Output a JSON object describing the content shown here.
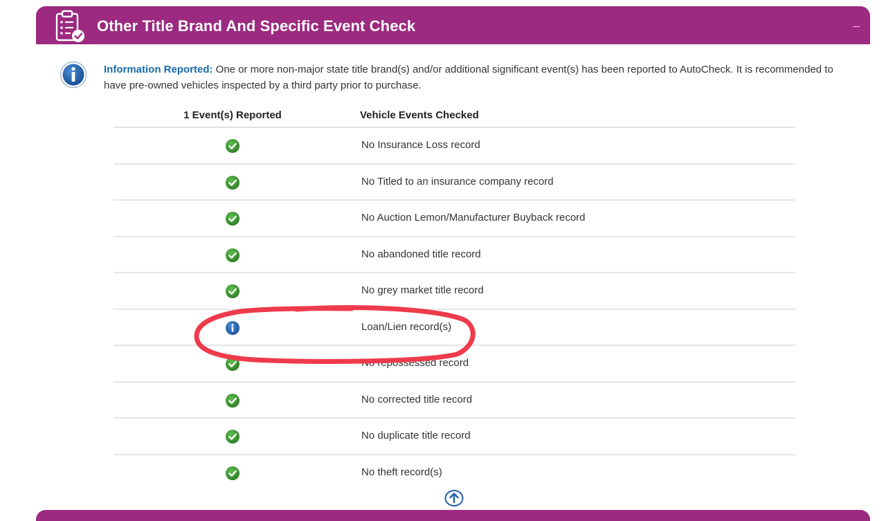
{
  "section": {
    "title": "Other Title Brand And Specific Event Check",
    "collapse_label": "–"
  },
  "info": {
    "label": "Information Reported:",
    "text": " One or more non-major state title brand(s) and/or additional significant event(s) has been reported to AutoCheck. It is recommended to have pre-owned vehicles inspected by a third party prior to purchase."
  },
  "table": {
    "headers": {
      "events_reported": "1 Event(s) Reported",
      "events_checked": "Vehicle Events Checked"
    },
    "rows": [
      {
        "status": "check",
        "label": "No Insurance Loss record"
      },
      {
        "status": "check",
        "label": "No Titled to an insurance company record"
      },
      {
        "status": "check",
        "label": "No Auction Lemon/Manufacturer Buyback record"
      },
      {
        "status": "check",
        "label": "No abandoned title record"
      },
      {
        "status": "check",
        "label": "No grey market title record"
      },
      {
        "status": "info",
        "label": "Loan/Lien record(s)"
      },
      {
        "status": "check",
        "label": "No repossessed record"
      },
      {
        "status": "check",
        "label": "No corrected title record"
      },
      {
        "status": "check",
        "label": "No duplicate title record"
      },
      {
        "status": "check",
        "label": "No theft record(s)"
      }
    ]
  },
  "colors": {
    "header_bg": "#9b2a80",
    "info_label": "#1a6aa8",
    "check_green": "#3f9a35",
    "info_blue": "#1f5fa8",
    "annotation_red": "#ee3b4b"
  }
}
